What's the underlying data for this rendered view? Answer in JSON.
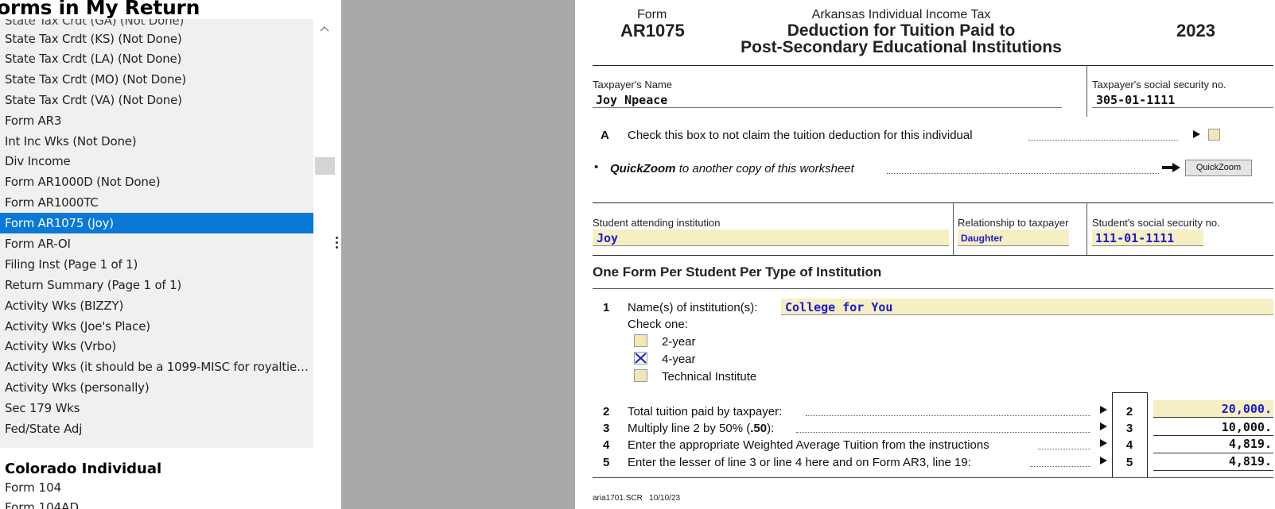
{
  "sidebar": {
    "title": "orms in My Return",
    "partial_top_item": "State Tax Crdt (GA) (Not Done)",
    "items": [
      {
        "label": "State Tax Crdt (KS) (Not Done)"
      },
      {
        "label": "State Tax Crdt (LA) (Not Done)"
      },
      {
        "label": "State Tax Crdt (MO) (Not Done)"
      },
      {
        "label": "State Tax Crdt (VA) (Not Done)"
      },
      {
        "label": "Form AR3"
      },
      {
        "label": "Int Inc Wks (Not Done)"
      },
      {
        "label": "Div Income"
      },
      {
        "label": "Form AR1000D (Not Done)"
      },
      {
        "label": "Form AR1000TC"
      },
      {
        "label": "Form AR1075 (Joy)"
      },
      {
        "label": "Form AR-OI"
      },
      {
        "label": "Filing Inst (Page 1 of 1)"
      },
      {
        "label": "Return Summary (Page 1 of 1)"
      },
      {
        "label": "Activity Wks (BIZZY)"
      },
      {
        "label": "Activity Wks (Joe's Place)"
      },
      {
        "label": "Activity Wks (Vrbo)"
      },
      {
        "label": "Activity Wks (it should be a 1099-MISC for royalties..."
      },
      {
        "label": "Activity Wks (personally)"
      },
      {
        "label": "Sec 179 Wks"
      },
      {
        "label": "Fed/State Adj"
      }
    ],
    "selected_item": "Form AR1075 (Joy)",
    "section2_title": "Colorado Individual",
    "section2_items": [
      "Form 104",
      "Form 104AD"
    ]
  },
  "form": {
    "form_word": "Form",
    "form_number": "AR1075",
    "agency_line": "Arkansas Individual Income Tax",
    "title_line1": "Deduction for Tuition Paid to",
    "title_line2": "Post-Secondary Educational Institutions",
    "year": "2023",
    "taxpayer_name_label": "Taxpayer's Name",
    "taxpayer_name": "Joy Npeace",
    "taxpayer_ssn_label": "Taxpayer's social security no.",
    "taxpayer_ssn": "305-01-1111",
    "line_a_letter": "A",
    "line_a_text": "Check this box to not claim the tuition deduction for this individual",
    "quickzoom_bold": "QuickZoom",
    "quickzoom_rest": "to another copy of this worksheet",
    "quickzoom_button": "QuickZoom",
    "student_label": "Student attending institution",
    "student_name": "Joy",
    "relationship_label": "Relationship to taxpayer",
    "relationship": "Daughter",
    "student_ssn_label": "Student's social security no.",
    "student_ssn": "111-01-1111",
    "section_heading": "One Form Per Student Per Type of Institution",
    "line1_num": "1",
    "line1_label": "Name(s) of institution(s):",
    "institution": "College for You",
    "check_one": "Check one:",
    "opt_2year": "2-year",
    "opt_4year": "4-year",
    "opt_tech": "Technical Institute",
    "selected_option": "4-year",
    "lines": [
      {
        "num": "2",
        "text": "Total tuition paid by taxpayer:",
        "amount": "20,000."
      },
      {
        "num": "3",
        "text_pre": "Multiply line 2 by 50% (",
        "text_bold": ".50",
        "text_post": "):",
        "amount": "10,000."
      },
      {
        "num": "4",
        "text": "Enter the appropriate Weighted Average Tuition from the instructions",
        "amount": "4,819."
      },
      {
        "num": "5",
        "text": "Enter the lesser of line 3 or line 4 here and on Form AR3, line 19:",
        "amount": "4,819."
      }
    ],
    "footer": "aria1701.SCR   10/10/23"
  },
  "colors": {
    "selection": "#0a78d7",
    "field_bg": "#f7efc4",
    "field_text": "#1a1ad4",
    "gutter": "#a9a9a9"
  }
}
